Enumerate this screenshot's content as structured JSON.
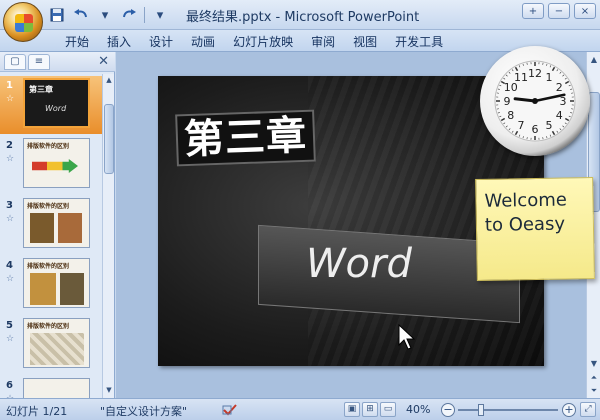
{
  "window": {
    "title": "最终结果.pptx - Microsoft PowerPoint",
    "controls": [
      "+",
      "−",
      "×"
    ]
  },
  "ribbon": {
    "tabs": [
      "开始",
      "插入",
      "设计",
      "动画",
      "幻灯片放映",
      "审阅",
      "视图",
      "开发工具"
    ]
  },
  "icons": {
    "office_button": "office-logo-icon",
    "save": "save-icon",
    "undo": "undo-icon",
    "redo": "redo-icon",
    "outline_tab": "outline-icon",
    "slides_tab": "slides-icon",
    "pane_close": "close-icon"
  },
  "thumbnails": [
    {
      "num": "1",
      "title": "第三章",
      "subtitle": "Word",
      "active": true
    },
    {
      "num": "2",
      "title": "排版软件的区别"
    },
    {
      "num": "3",
      "title": "排版软件的区别"
    },
    {
      "num": "4",
      "title": "排版软件的区别"
    },
    {
      "num": "5",
      "title": "排版软件的区别"
    },
    {
      "num": "6",
      "title": ""
    }
  ],
  "slide": {
    "heading": "第三章",
    "subtitle": "Word"
  },
  "clock": {
    "numerals": [
      "12",
      "1",
      "2",
      "3",
      "4",
      "5",
      "6",
      "7",
      "8",
      "9",
      "10",
      "11"
    ],
    "hour": 9,
    "minute": 13
  },
  "sticky_note": {
    "line1": "Welcome",
    "line2": "to Oeasy"
  },
  "statusbar": {
    "slide_info": "幻灯片 1/21",
    "theme": "\"自定义设计方案\"",
    "zoom": "40%"
  },
  "colors": {
    "accent": "#f2a33a",
    "ribbon": "#c2d5ee",
    "slide_bg": "#1c1c1c"
  }
}
